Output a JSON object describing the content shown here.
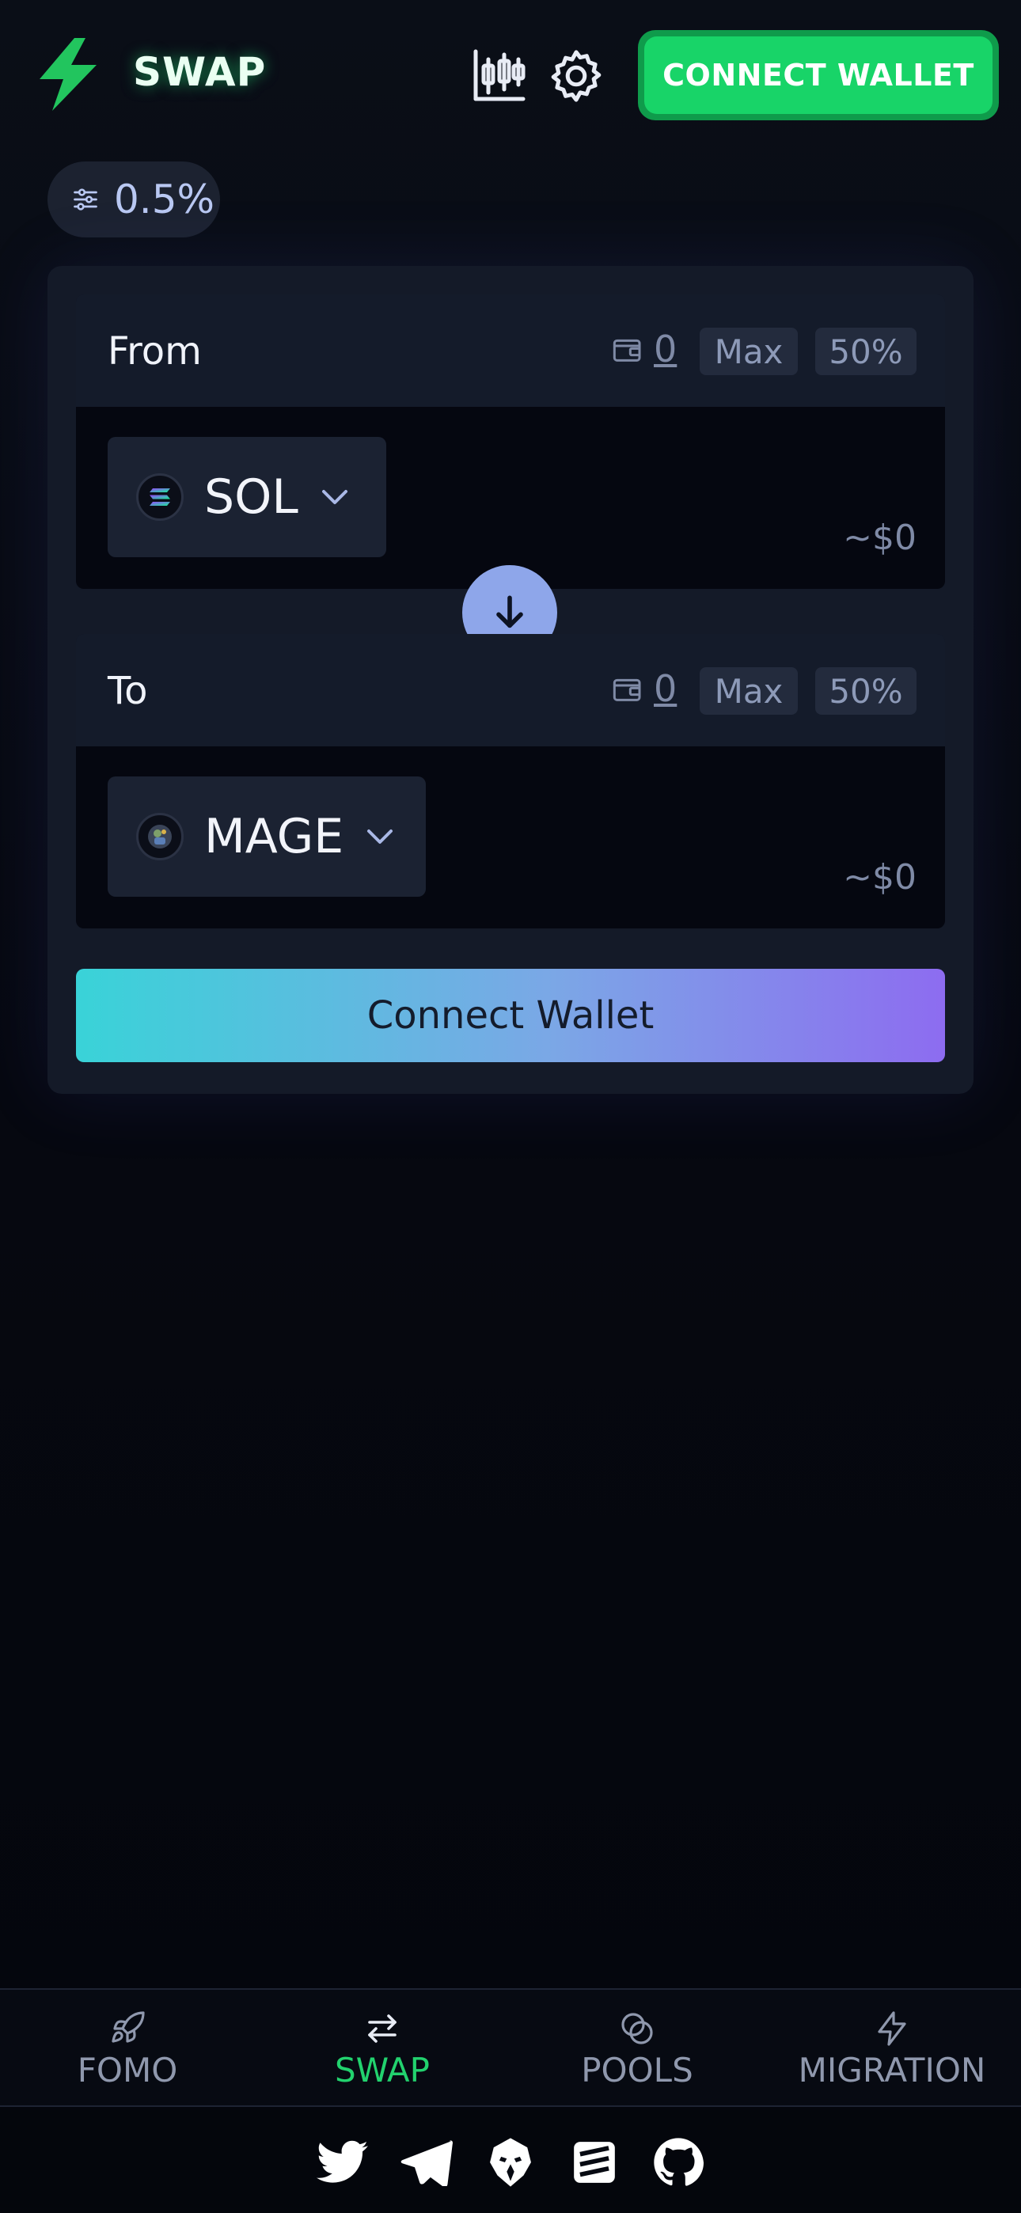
{
  "header": {
    "brand": "SWAP",
    "connect_label": "CONNECT WALLET",
    "icons": [
      "lightning-logo-icon",
      "candlestick-chart-icon",
      "gear-icon"
    ]
  },
  "slippage": {
    "value": "0.5%",
    "icon": "sliders-icon"
  },
  "from": {
    "label": "From",
    "balance": "0",
    "max_label": "Max",
    "half_label": "50%",
    "token": "SOL",
    "usd": "~$0"
  },
  "to": {
    "label": "To",
    "balance": "0",
    "max_label": "Max",
    "half_label": "50%",
    "token": "MAGE",
    "usd": "~$0"
  },
  "connect_main_label": "Connect Wallet",
  "nav": {
    "items": [
      {
        "label": "FOMO",
        "icon": "rocket-icon"
      },
      {
        "label": "SWAP",
        "icon": "swap-arrows-icon"
      },
      {
        "label": "POOLS",
        "icon": "pools-icon"
      },
      {
        "label": "MIGRATION",
        "icon": "lightning-icon"
      }
    ]
  },
  "socials": [
    "twitter-icon",
    "telegram-icon",
    "eagle-icon",
    "stack-icon",
    "github-icon"
  ],
  "colors": {
    "accent_green": "#18d468",
    "switch_button": "#8ea6ea",
    "gradient_start": "#39d3d8",
    "gradient_end": "#8d6cf0"
  }
}
